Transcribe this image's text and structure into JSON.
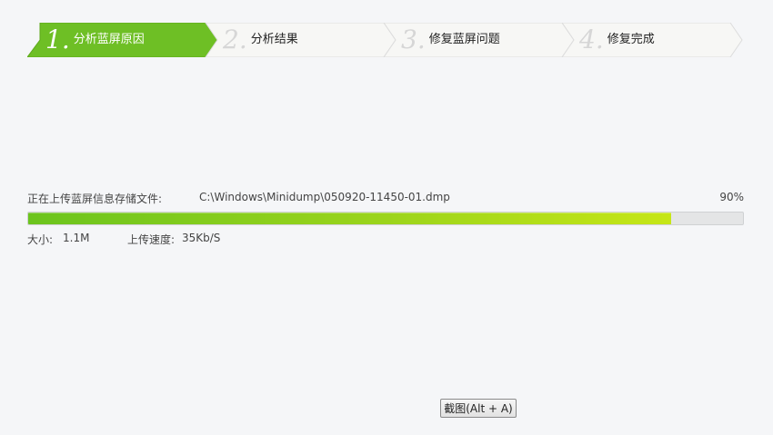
{
  "steps": [
    {
      "number": "1.",
      "label": "分析蓝屏原因",
      "active": true
    },
    {
      "number": "2.",
      "label": "分析结果",
      "active": false
    },
    {
      "number": "3.",
      "label": "修复蓝屏问题",
      "active": false
    },
    {
      "number": "4.",
      "label": "修复完成",
      "active": false
    }
  ],
  "upload": {
    "status_text": "正在上传蓝屏信息存储文件:",
    "file_path": "C:\\Windows\\Minidump\\050920-11450-01.dmp",
    "percent_text": "90%",
    "progress": 0.9,
    "size_label": "大小:",
    "size_value": "1.1M",
    "speed_label": "上传速度:",
    "speed_value": "35Kb/S"
  },
  "screenshot_button": {
    "label": "截图(Alt + A)"
  },
  "colors": {
    "active_step": "#6ebf25",
    "inactive_step": "#f7f7f5",
    "progress_start": "#6cc41e",
    "progress_end": "#c6e617"
  }
}
